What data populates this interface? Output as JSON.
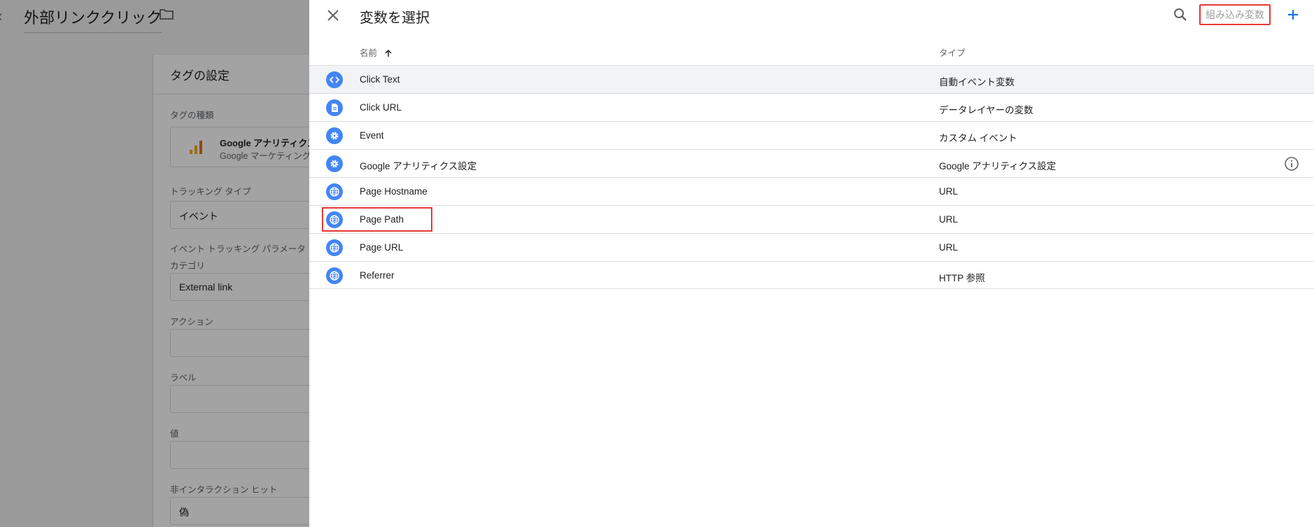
{
  "background": {
    "page_title": "外部リンククリック",
    "card_title": "タグの設定",
    "tag_type_label": "タグの種類",
    "tag_type_name": "Google アナリティクス",
    "tag_type_sub": "Google マーケティング",
    "tracking_type_label": "トラッキング タイプ",
    "tracking_type_value": "イベント",
    "event_params_label": "イベント トラッキング パラメータ",
    "category_label": "カテゴリ",
    "category_value": "External link",
    "action_label": "アクション",
    "label_label": "ラベル",
    "value_label": "値",
    "non_interaction_label": "非インタラクション ヒット",
    "non_interaction_value": "偽"
  },
  "panel": {
    "title": "変数を選択",
    "builtin_label": "組み込み変数",
    "columns": {
      "name": "名前",
      "type": "タイプ"
    },
    "rows": [
      {
        "name": "Click Text",
        "type": "自動イベント変数",
        "icon": "code-icon"
      },
      {
        "name": "Click URL",
        "type": "データレイヤーの変数",
        "icon": "document-icon"
      },
      {
        "name": "Event",
        "type": "カスタム イベント",
        "icon": "gear-icon"
      },
      {
        "name": "Google アナリティクス設定",
        "type": "Google アナリティクス設定",
        "icon": "gear-icon"
      },
      {
        "name": "Page Hostname",
        "type": "URL",
        "icon": "globe-icon"
      },
      {
        "name": "Page Path",
        "type": "URL",
        "icon": "globe-icon"
      },
      {
        "name": "Page URL",
        "type": "URL",
        "icon": "globe-icon"
      },
      {
        "name": "Referrer",
        "type": "HTTP 参照",
        "icon": "globe-icon"
      }
    ]
  },
  "colors": {
    "accent": "#4285f4",
    "highlight_box": "#e53935",
    "overlay": "#5c5c5c"
  }
}
